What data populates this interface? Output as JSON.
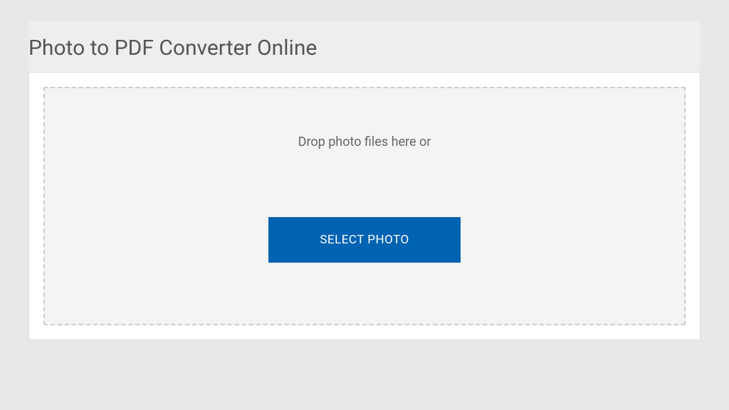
{
  "page": {
    "title": "Photo to PDF Converter Online"
  },
  "dropzone": {
    "instruction": "Drop photo files here or",
    "select_button_label": "SELECT PHOTO"
  }
}
